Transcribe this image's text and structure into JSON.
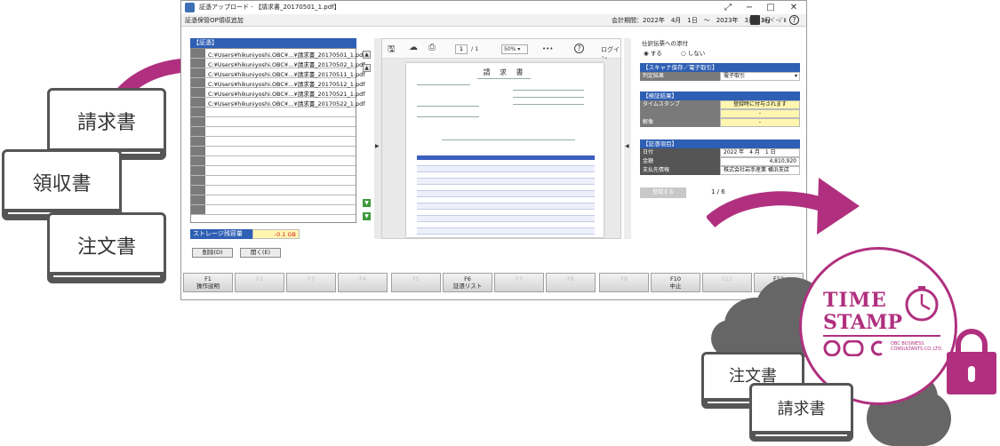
{
  "window": {
    "title": "証憑アップロード - 【請求書_20170501_1.pdf】",
    "controls": [
      "⤢",
      "−",
      "□",
      "✕"
    ]
  },
  "menubar": {
    "crumb": "証憑保管OP領収追加",
    "period": "会計期間：2022年　4月　1日　～　2023年　3月 31日",
    "mypage": "MyﾍﾟｰｼﾞⅡ",
    "help": "?"
  },
  "file_list": {
    "header": "【証憑】",
    "rows": [
      "C:¥Users¥hikuniyoshi.OBC¥…¥請求書_20170501_1.pdf",
      "C:¥Users¥hikuniyoshi.OBC¥…¥請求書_20170502_1.pdf",
      "C:¥Users¥hikuniyoshi.OBC¥…¥請求書_20170511_1.pdf",
      "C:¥Users¥hikuniyoshi.OBC¥…¥請求書_20170512_1.pdf",
      "C:¥Users¥hikuniyoshi.OBC¥…¥請求書_20170521_1.pdf",
      "C:¥Users¥hikuniyoshi.OBC¥…¥請求書_20170522_1.pdf"
    ],
    "storage_label": "ストレージ残容量",
    "storage_value": "-0.1 GB",
    "delete_button": "削除(D)",
    "open_button": "開く(E)"
  },
  "viewer": {
    "page_current": "1",
    "page_total": "/ 1",
    "zoom": "50%",
    "more": "•••",
    "help": "?",
    "login": "ログイン",
    "doc_title": "請 求 書"
  },
  "right_panel": {
    "attach_caption": "仕訳伝票への添付",
    "radio_yes": "する",
    "radio_no": "しない",
    "scan_header": "【スキャナ保存／電子取引】",
    "judge_key": "判定結果",
    "judge_value": "電子取引",
    "verify_header": "【検証結果】",
    "timestamp_key": "タイムスタンプ",
    "timestamp_value": "登録時に付与されます",
    "verify_row2_value": "-",
    "verify_row3_key": "解像",
    "verify_row3_value": "-",
    "items_header": "【証憑項目】",
    "date_key": "日付",
    "date_value": "2022 年　4 月　1 日",
    "amount_key": "金額",
    "amount_value": "4,810,920",
    "payee_key": "支払先情報",
    "payee_value": "株式会社岩手産業 横浜支店",
    "register_button": "登録する",
    "page_count": "1 / 6"
  },
  "function_keys": [
    {
      "key": "F1",
      "label": "操作説明",
      "enabled": true
    },
    {
      "key": "",
      "label": "F2",
      "enabled": false
    },
    {
      "key": "",
      "label": "F3",
      "enabled": false
    },
    {
      "key": "",
      "label": "F4",
      "enabled": false
    },
    {
      "key": "",
      "label": "F5",
      "enabled": false
    },
    {
      "key": "F6",
      "label": "証憑リスト",
      "enabled": true
    },
    {
      "key": "",
      "label": "F7",
      "enabled": false
    },
    {
      "key": "",
      "label": "F8",
      "enabled": false
    },
    {
      "key": "",
      "label": "F9",
      "enabled": false
    },
    {
      "key": "F10",
      "label": "中止",
      "enabled": true
    },
    {
      "key": "",
      "label": "F11",
      "enabled": false
    },
    {
      "key": "F12",
      "label": "",
      "enabled": true
    }
  ],
  "illustration": {
    "doc_left_1": "請求書",
    "doc_left_2": "領収書",
    "doc_left_3": "注文書",
    "doc_right_1": "注文書",
    "doc_right_2": "請求書",
    "stamp_line1": "TIME",
    "stamp_line2": "STAMP",
    "obc_text": "OBC BUSINESS CONSULTANTS CO.,LTD.",
    "accent_color": "#b0307f"
  }
}
